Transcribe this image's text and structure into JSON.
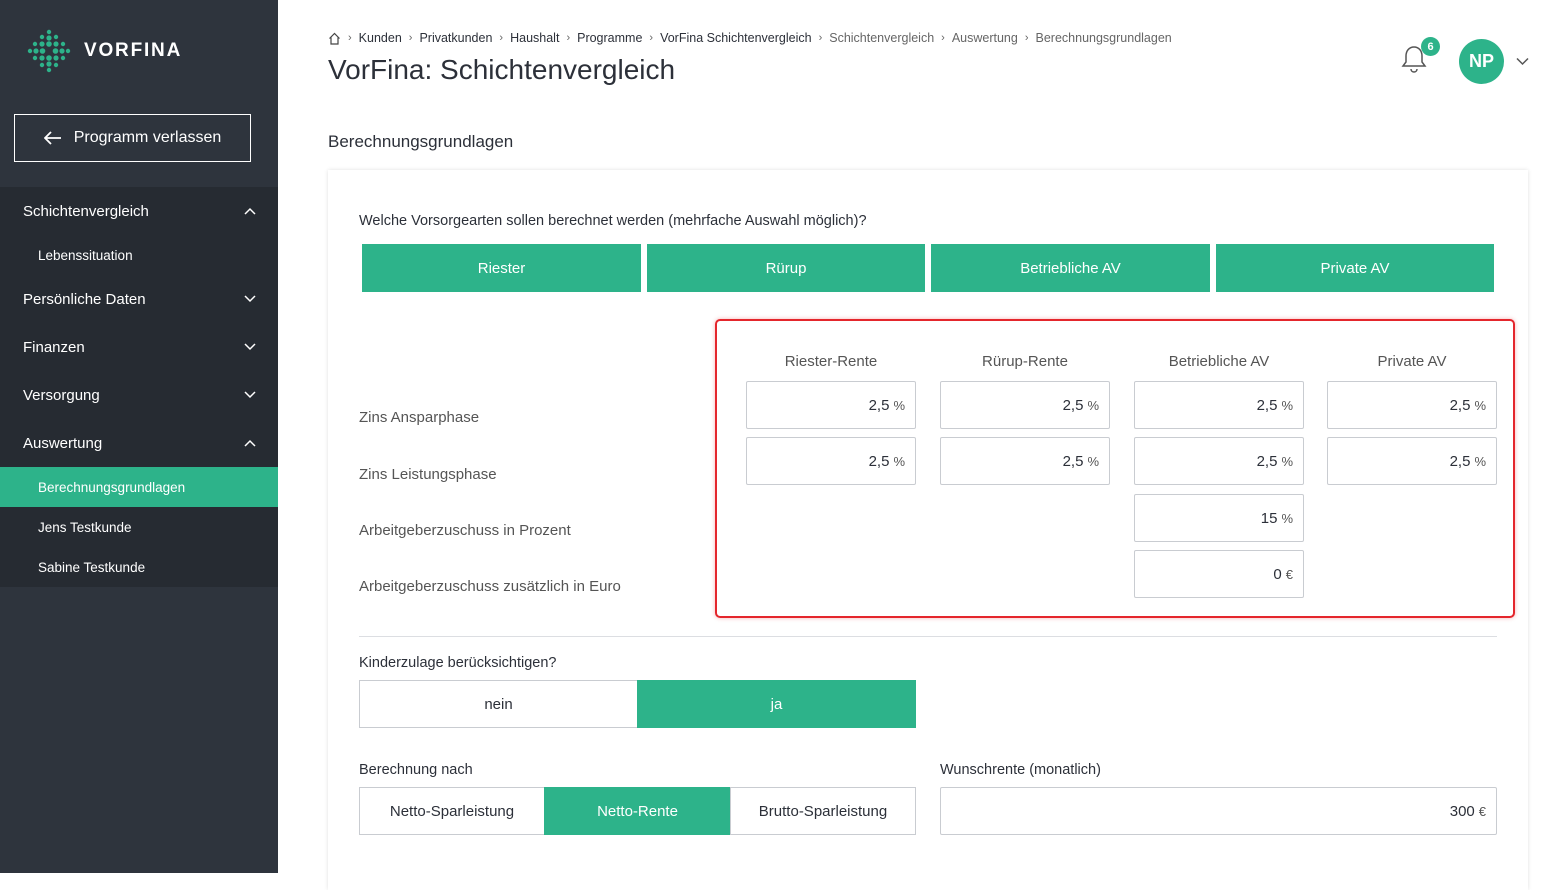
{
  "brand": {
    "name": "VORFINA",
    "accent": "#2db38a"
  },
  "sidebar": {
    "exit_label": "Programm verlassen",
    "items": [
      {
        "label": "Schichtenvergleich",
        "icon": "chevron-up-icon"
      },
      {
        "label": "Lebenssituation"
      },
      {
        "label": "Persönliche Daten",
        "icon": "chevron-down-icon"
      },
      {
        "label": "Finanzen",
        "icon": "chevron-down-icon"
      },
      {
        "label": "Versorgung",
        "icon": "chevron-down-icon"
      },
      {
        "label": "Auswertung",
        "icon": "chevron-up-icon"
      },
      {
        "label": "Berechnungsgrundlagen",
        "active": true
      },
      {
        "label": "Jens Testkunde"
      },
      {
        "label": "Sabine Testkunde"
      }
    ]
  },
  "header": {
    "breadcrumb": [
      "Kunden",
      "Privatkunden",
      "Haushalt",
      "Programme",
      "VorFina Schichtenvergleich",
      "Schichtenvergleich",
      "Auswertung",
      "Berechnungsgrundlagen"
    ],
    "title": "VorFina: Schichtenvergleich",
    "notifications": "6",
    "avatar_initials": "NP"
  },
  "main": {
    "section_title": "Berechnungsgrundlagen",
    "question": "Welche Vorsorgearten sollen berechnet werden (mehrfache Auswahl möglich)?",
    "types": [
      "Riester",
      "Rürup",
      "Betriebliche AV",
      "Private AV"
    ],
    "columns": [
      "Riester-Rente",
      "Rürup-Rente",
      "Betriebliche AV",
      "Private AV"
    ],
    "rows": {
      "zins_anspar": {
        "label": "Zins Ansparphase",
        "values": [
          "2,5",
          "2,5",
          "2,5",
          "2,5"
        ],
        "unit": "%"
      },
      "zins_leistung": {
        "label": "Zins Leistungsphase",
        "values": [
          "2,5",
          "2,5",
          "2,5",
          "2,5"
        ],
        "unit": "%"
      },
      "ag_prozent": {
        "label": "Arbeitgeberzuschuss in Prozent",
        "value": "15",
        "unit": "%"
      },
      "ag_euro": {
        "label": "Arbeitgeberzuschuss zusätzlich in Euro",
        "value": "0",
        "unit": "€"
      }
    },
    "kinderzulage": {
      "label": "Kinderzulage berücksichtigen?",
      "options": [
        "nein",
        "ja"
      ],
      "selected": "ja"
    },
    "berechnung": {
      "label": "Berechnung nach",
      "options": [
        "Netto-Sparleistung",
        "Netto-Rente",
        "Brutto-Sparleistung"
      ],
      "selected": "Netto-Rente"
    },
    "wunschrente": {
      "label": "Wunschrente (monatlich)",
      "value": "300",
      "unit": "€"
    }
  }
}
